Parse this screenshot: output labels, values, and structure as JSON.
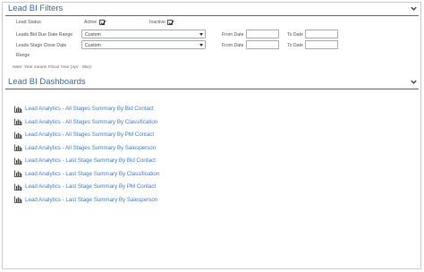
{
  "filters": {
    "title": "Lead BI Filters",
    "lead_status_label": "Lead Status",
    "active_label": "Active",
    "active_checked": true,
    "inactive_label": "Inactive",
    "inactive_checked": true,
    "bid_due_label": "Leads Bid Due Date Range",
    "bid_due_value": "Custom",
    "stage_close_label": "Leads Stage Close Date",
    "stage_close_label2": "Range",
    "stage_close_value": "Custom",
    "from_date_label": "From Date",
    "to_date_label": "To Date",
    "note": "Note: Year means Fiscal Year (Apr - Mar)"
  },
  "dashboards": {
    "title": "Lead BI Dashboards",
    "items": [
      "Lead Analytics - All Stages Summary By Bid Contact",
      "Lead Analytics - All Stages Summary By Classification",
      "Lead Analytics - All Stages Summary By PM Contact",
      "Lead Analytics - All Stages Summary By Salesperson",
      "Lead Analytics - Last Stage Summary By Bid Contact",
      "Lead Analytics - Last Stage Summary By Classification",
      "Lead Analytics - Last Stage Summary By PM Contact",
      "Lead Analytics - Last Stage Summary By Salesperson"
    ]
  },
  "colors": {
    "accent": "#2f6db5",
    "link": "#3e7cc8",
    "border": "#3b73b9"
  },
  "icons": {
    "collapse": "chevron-down-icon",
    "dashboard": "bar-chart-icon"
  }
}
